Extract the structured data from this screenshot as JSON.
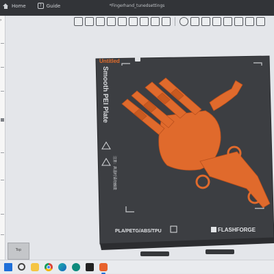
{
  "titlebar": {
    "home_tab": "Home",
    "guide_tab": "Guide",
    "document_title": "*Fingerhand_tunedsettings"
  },
  "toolbar": {
    "icons": [
      "add-object-icon",
      "grid-icon",
      "import-icon",
      "orient-icon",
      "arrange-icon",
      "layers-icon",
      "cut-icon",
      "split-icon",
      "text-icon",
      "move-icon",
      "rotate-icon",
      "scale-icon",
      "paint-icon",
      "seam-icon",
      "support-icon",
      "assembly-icon",
      "measure-icon"
    ]
  },
  "plate": {
    "name": "Untitled",
    "plate_type": "Smooth PEI Plate",
    "materials": "PLA/PETG/ABS/TPU",
    "brand": "FLASHFORGE",
    "warning_text": "注意：高温时请勿触摸",
    "colors": {
      "plate": "#3c3e42",
      "model": "#e06a2c",
      "name_color": "#e46c2a"
    }
  },
  "view_cube": {
    "label": "Top"
  },
  "taskbar": {
    "apps": [
      "windows-start-icon",
      "search-icon",
      "file-explorer-icon",
      "chrome-icon",
      "edge-icon",
      "teal-app-icon",
      "dark-app-icon",
      "slicer-app-icon"
    ]
  }
}
